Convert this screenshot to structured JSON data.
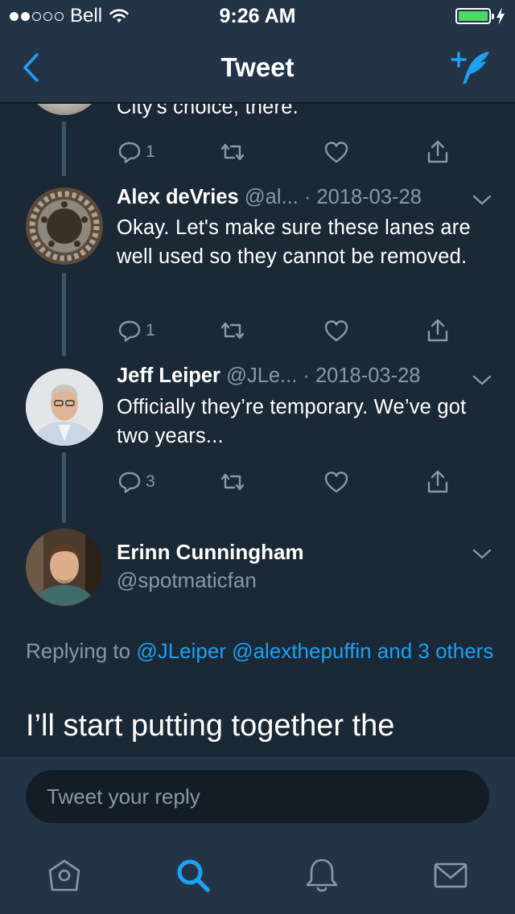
{
  "status_bar": {
    "carrier": "Bell",
    "time": "9:26 AM",
    "signal_bars": 2
  },
  "nav": {
    "title": "Tweet",
    "back_icon": "chevron-left-icon",
    "compose_icon": "compose-tweet-icon"
  },
  "tweets": [
    {
      "text": "City's choice, there.",
      "replies": "1"
    },
    {
      "name": "Alex deVries",
      "handle": "@al...",
      "date": "· 2018-03-28",
      "text": "Okay. Let's make sure these lanes are well used so they cannot be removed.",
      "replies": "1"
    },
    {
      "name": "Jeff Leiper",
      "handle": "@JLe...",
      "date": "· 2018-03-28",
      "text": "Officially they’re temporary. We’ve got two years...",
      "replies": "3"
    }
  ],
  "main_tweet": {
    "name": "Erinn Cunningham",
    "handle": "@spotmaticfan",
    "replying_prefix": "Replying to",
    "replying_users": "@JLeiper @alexthepuffin and 3 others",
    "text": "I’ll start putting together the"
  },
  "reply": {
    "placeholder": "Tweet your reply"
  },
  "tabbar": {
    "tabs": [
      "home-icon",
      "search-icon",
      "notifications-icon",
      "messages-icon"
    ],
    "active": "search-icon"
  },
  "colors": {
    "accent": "#1da1f2",
    "background": "#141d26",
    "bar": "#243447",
    "muted": "#8899a6",
    "battery": "#4cd964"
  }
}
